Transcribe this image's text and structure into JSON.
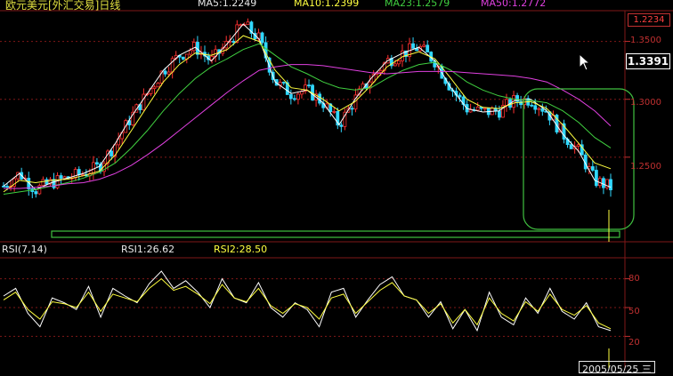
{
  "header": {
    "title": "欧元美元[外汇交易]日线",
    "ma5": "MA5:1.2249",
    "ma10": "MA10:1.2399",
    "ma23": "MA23:1.2579",
    "ma50": "MA50:1.2772"
  },
  "price_axis": {
    "top_value": "1.2234",
    "ticks": [
      "1.3500",
      "1.3000",
      "1.2500"
    ],
    "current_price": "1.3391"
  },
  "rsi_panel": {
    "name": "RSI(7,14)",
    "rsi1": "RSI1:26.62",
    "rsi2": "RSI2:28.50",
    "ticks": [
      "80",
      "50",
      "20"
    ]
  },
  "bottom_date": "2005/05/25 三",
  "colors": {
    "up_candle": "#ff3030",
    "down_candle": "#30d8ff",
    "ma5": "#ffffff",
    "ma10": "#ffff40",
    "ma23": "#40d040",
    "ma50": "#e040e0",
    "rsi1": "#ffffff",
    "rsi2": "#ffff40",
    "grid": "#801818",
    "highlight": "#40c040"
  },
  "chart_data": [
    {
      "type": "candlestick",
      "title": "欧元美元[外汇交易]日线",
      "ylim": [
        1.18,
        1.375
      ],
      "y_ticks": [
        1.35,
        1.3,
        1.25
      ],
      "grid": true,
      "series": [
        {
          "name": "MA5",
          "values": [
            1.225,
            1.236,
            1.222,
            1.228,
            1.232,
            1.236,
            1.242,
            1.262,
            1.285,
            1.305,
            1.325,
            1.338,
            1.345,
            1.333,
            1.348,
            1.365,
            1.352,
            1.315,
            1.305,
            1.308,
            1.297,
            1.278,
            1.3,
            1.318,
            1.333,
            1.34,
            1.345,
            1.333,
            1.31,
            1.292,
            1.289,
            1.29,
            1.299,
            1.3,
            1.29,
            1.27,
            1.255,
            1.23,
            1.224
          ]
        },
        {
          "name": "MA10",
          "values": [
            1.22,
            1.23,
            1.228,
            1.23,
            1.231,
            1.234,
            1.238,
            1.252,
            1.273,
            1.294,
            1.315,
            1.33,
            1.34,
            1.338,
            1.343,
            1.355,
            1.35,
            1.325,
            1.31,
            1.308,
            1.3,
            1.29,
            1.298,
            1.312,
            1.328,
            1.337,
            1.341,
            1.335,
            1.318,
            1.3,
            1.293,
            1.292,
            1.297,
            1.298,
            1.292,
            1.278,
            1.262,
            1.245,
            1.24
          ]
        },
        {
          "name": "MA23",
          "values": [
            1.218,
            1.22,
            1.222,
            1.225,
            1.228,
            1.232,
            1.237,
            1.245,
            1.258,
            1.273,
            1.29,
            1.305,
            1.318,
            1.328,
            1.335,
            1.343,
            1.348,
            1.338,
            1.328,
            1.322,
            1.315,
            1.31,
            1.308,
            1.31,
            1.318,
            1.325,
            1.33,
            1.332,
            1.325,
            1.315,
            1.308,
            1.303,
            1.3,
            1.299,
            1.297,
            1.29,
            1.28,
            1.267,
            1.258
          ]
        },
        {
          "name": "MA50",
          "values": [
            1.223,
            1.223,
            1.224,
            1.225,
            1.227,
            1.228,
            1.231,
            1.236,
            1.243,
            1.252,
            1.262,
            1.273,
            1.284,
            1.295,
            1.306,
            1.316,
            1.325,
            1.328,
            1.33,
            1.33,
            1.329,
            1.327,
            1.325,
            1.323,
            1.322,
            1.323,
            1.324,
            1.324,
            1.324,
            1.323,
            1.322,
            1.321,
            1.32,
            1.318,
            1.315,
            1.308,
            1.3,
            1.29,
            1.277
          ]
        }
      ]
    },
    {
      "type": "line",
      "title": "RSI(7,14)",
      "ylim": [
        0,
        100
      ],
      "y_ticks": [
        80,
        50,
        20
      ],
      "series": [
        {
          "name": "RSI1",
          "values": [
            62,
            70,
            44,
            30,
            60,
            55,
            48,
            72,
            40,
            70,
            62,
            55,
            75,
            88,
            70,
            78,
            66,
            50,
            80,
            60,
            55,
            76,
            50,
            40,
            55,
            48,
            30,
            66,
            70,
            40,
            58,
            74,
            82,
            62,
            58,
            40,
            56,
            28,
            48,
            26,
            66,
            40,
            32,
            60,
            44,
            70,
            46,
            38,
            55,
            30,
            26
          ]
        },
        {
          "name": "RSI2",
          "values": [
            58,
            66,
            48,
            38,
            56,
            54,
            50,
            66,
            46,
            64,
            60,
            56,
            70,
            80,
            68,
            72,
            64,
            54,
            74,
            60,
            56,
            70,
            52,
            44,
            54,
            50,
            38,
            60,
            64,
            44,
            56,
            68,
            76,
            62,
            58,
            44,
            54,
            34,
            48,
            32,
            60,
            44,
            36,
            56,
            46,
            64,
            48,
            42,
            52,
            34,
            28
          ]
        }
      ]
    }
  ]
}
